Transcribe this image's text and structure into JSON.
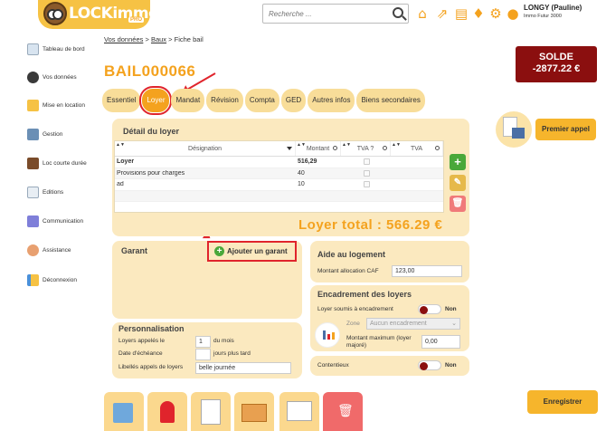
{
  "header": {
    "logo_text": "LOCKimmo.io",
    "logo_badge": "PRO",
    "search_placeholder": "Recherche ...",
    "user_name": "LONGY (Pauline)",
    "user_sub": "Immo Futur 3000"
  },
  "sidebar": {
    "items": [
      {
        "label": "Tableau de bord"
      },
      {
        "label": "Vos données"
      },
      {
        "label": "Mise en location"
      },
      {
        "label": "Gestion"
      },
      {
        "label": "Loc courte durée"
      },
      {
        "label": "Editions"
      },
      {
        "label": "Communication"
      },
      {
        "label": "Assistance"
      },
      {
        "label": "Déconnexion"
      }
    ]
  },
  "breadcrumb": {
    "part1": "Vos données",
    "sep": ">",
    "part2": "Baux",
    "part3": "Fiche bail"
  },
  "title": "BAIL000066",
  "solde": {
    "label": "SOLDE",
    "value": "-2877.22 €"
  },
  "tabs": [
    "Essentiel",
    "Loyer",
    "Mandat",
    "Révision",
    "Compta",
    "GED",
    "Autres infos",
    "Biens secondaires"
  ],
  "active_tab": "Loyer",
  "detail": {
    "title": "Détail du loyer",
    "columns": [
      "Désignation",
      "Montant",
      "TVA ?",
      "TVA"
    ],
    "rows": [
      {
        "designation": "Loyer",
        "montant": "516,29",
        "bold": true
      },
      {
        "designation": "Provisions pour charges",
        "montant": "40",
        "bold": false
      },
      {
        "designation": "ad",
        "montant": "10",
        "bold": false
      }
    ],
    "total": "Loyer total : 566.29 €"
  },
  "premier_appel": "Premier appel",
  "garant": {
    "title": "Garant",
    "add_label": "Ajouter un garant"
  },
  "aide": {
    "title": "Aide au logement",
    "label": "Montant allocation CAF",
    "value": "123,00"
  },
  "perso": {
    "title": "Personnalisation",
    "loyers_label": "Loyers appelés le",
    "loyers_value": "1",
    "loyers_unit": "du mois",
    "echeance_label": "Date d'échéance",
    "echeance_value": "",
    "echeance_unit": "jours plus tard",
    "libelles_label": "Libellés appels de loyers",
    "libelles_value": "belle journée"
  },
  "encadrement": {
    "title": "Encadrement des loyers",
    "soumis_label": "Loyer soumis à encadrement",
    "soumis_value": "Non",
    "zone_label": "Zone",
    "zone_value": "Aucun encadrement",
    "max_label": "Montant maximum (loyer majoré)",
    "max_value": "0,00"
  },
  "contentieux": {
    "label": "Contentieux",
    "value": "Non"
  },
  "save_label": "Enregistrer",
  "colors": {
    "accent": "#f4a21e",
    "panel": "#fbe9bf",
    "solde_bg": "#8b0f0f",
    "highlight": "#e0242c"
  }
}
